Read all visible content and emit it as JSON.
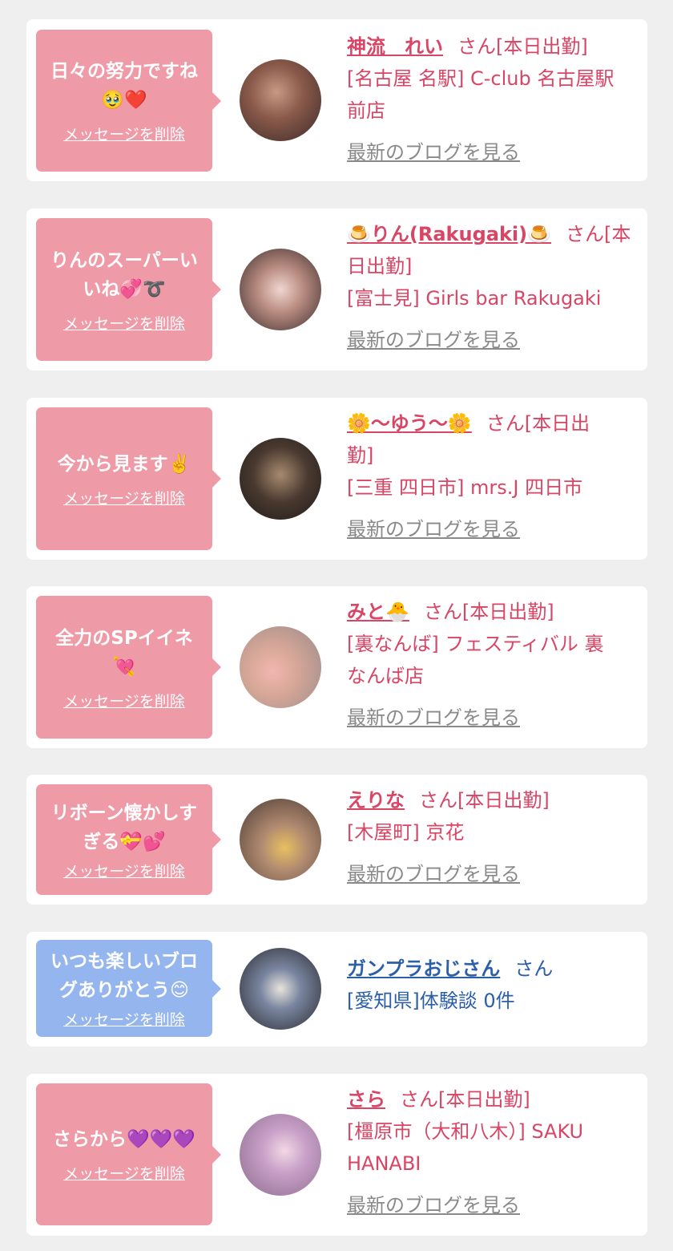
{
  "colors": {
    "pink_bubble": "#ef9aa7",
    "blue_bubble": "#94b5ee",
    "name_pink": "#d94565",
    "name_blue": "#2b5fa7",
    "link_gray": "#8a8a8a",
    "bg": "#efefef"
  },
  "delete_label": "メッセージを削除",
  "blog_label": "最新のブログを見る",
  "messages": [
    {
      "msg1": "日々の努力ですね",
      "msg2": "🥹❤️",
      "name": "神流　れい",
      "suffix": "さん[本日出勤]",
      "shop1": "[名古屋 名駅] C-club 名古屋駅",
      "shop2": "前店"
    },
    {
      "msg1": "りんのスーパーい",
      "msg2": "いね💞➰",
      "name": "🍮りん(Rakugaki)🍮",
      "suffix": "さん[本",
      "suffix2": "日出勤]",
      "shop1": "[富士見] Girls bar Rakugaki"
    },
    {
      "msg1": "今から見ます✌️",
      "name": "🌼〜ゆう〜🌼",
      "suffix": "さん[本日出",
      "suffix2": "勤]",
      "shop1": "[三重 四日市] mrs.J 四日市"
    },
    {
      "msg1": "全力のSPイイネ",
      "msg2": "💘",
      "name": "みと🐣",
      "suffix": "さん[本日出勤]",
      "shop1": "[裏なんば] フェスティバル 裏",
      "shop2": "なんば店"
    },
    {
      "msg1": "リボーン懐かしす",
      "msg2": "ぎる💝💕",
      "name": "えりな",
      "suffix": "さん[本日出勤]",
      "shop1": "[木屋町] 京花"
    },
    {
      "msg1": "いつも楽しいブロ",
      "msg2": "グありがとう😊",
      "name": "ガンプラおじさん",
      "suffix": "さん",
      "shop1": "[愛知県]体験談 0件"
    },
    {
      "msg1": "さらから💜💜💜",
      "name": "さら",
      "suffix": "さん[本日出勤]",
      "shop1": "[橿原市（大和八木）] SAKU",
      "shop2": "HANABI"
    }
  ]
}
